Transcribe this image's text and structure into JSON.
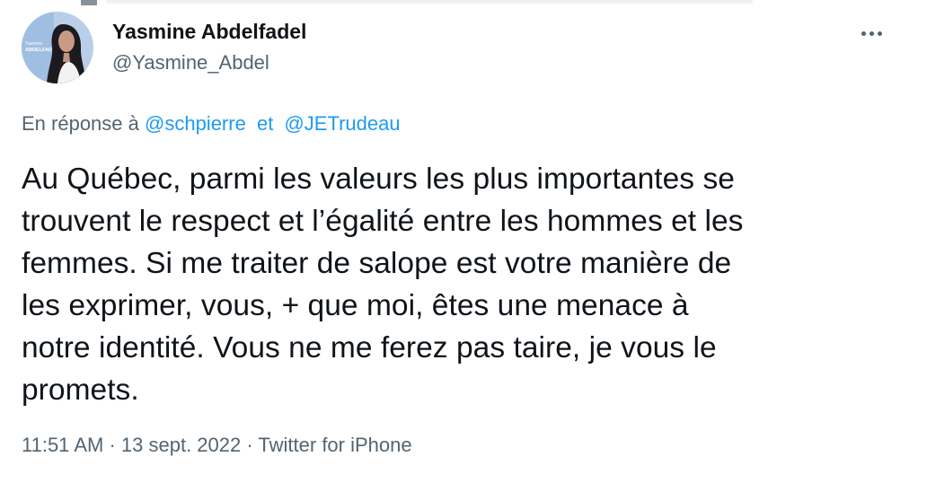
{
  "tweet": {
    "author": {
      "name": "Yasmine Abdelfadel",
      "handle": "@Yasmine_Abdel",
      "avatar_icon": "profile-photo",
      "avatar_text": "Yasmine ABDELFADEL"
    },
    "more_icon": "more-dots-icon",
    "reply_to": {
      "prefix": "En réponse à",
      "mentions": [
        "@schpierre",
        "@JETrudeau"
      ],
      "separator": "et"
    },
    "text_lines": [
      "Au Québec, parmi les valeurs les plus importantes se",
      "trouvent le respect et l’égalité entre les hommes et les",
      "femmes. Si me traiter de salope est votre manière de",
      "les exprimer, vous, + que moi, êtes une menace à",
      "notre identité. Vous ne me ferez pas taire, je vous le",
      "promets."
    ],
    "time": "11:51 AM",
    "date": "13 sept. 2022",
    "source": "Twitter for iPhone",
    "separator": "·"
  },
  "colors": {
    "text": "#0f1419",
    "secondary": "#536471",
    "link": "#1d9bf0",
    "background": "#ffffff"
  }
}
